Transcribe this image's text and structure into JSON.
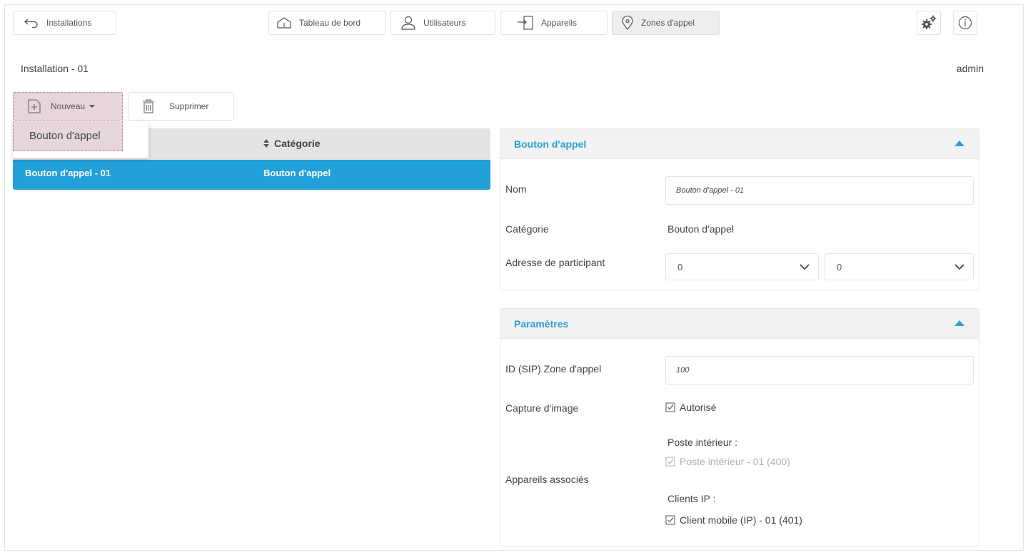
{
  "nav": {
    "back_label": "Installations",
    "tabs": [
      {
        "label": "Tableau de bord",
        "icon": "home-icon"
      },
      {
        "label": "Utilisateurs",
        "icon": "user-icon"
      },
      {
        "label": "Appareils",
        "icon": "device-icon"
      },
      {
        "label": "Zones d'appel",
        "icon": "location-pin-icon",
        "active": true
      }
    ],
    "settings_icon": "gears-icon",
    "info_icon": "info-icon"
  },
  "header": {
    "installation": "Installation - 01",
    "user": "admin"
  },
  "toolbar": {
    "new_label": "Nouveau",
    "delete_label": "Supprimer",
    "dropdown_items": [
      "Bouton d'appel"
    ]
  },
  "table": {
    "columns": [
      "Catégorie"
    ],
    "rows": [
      {
        "name": "Bouton d'appel - 01",
        "category": "Bouton d'appel",
        "selected": true
      }
    ]
  },
  "panel_main": {
    "title": "Bouton d'appel",
    "name_label": "Nom",
    "name_value": "Bouton d'appel - 01",
    "category_label": "Catégorie",
    "category_value": "Bouton d'appel",
    "address_label": "Adresse de participant",
    "address_values": [
      "0",
      "0"
    ]
  },
  "panel_params": {
    "title": "Paramètres",
    "sip_label": "ID (SIP) Zone d'appel",
    "sip_value": "100",
    "capture_label": "Capture d'image",
    "capture_option": "Autorisé",
    "devices_label": "Appareils associés",
    "indoor_group": "Poste intérieur :",
    "indoor_item": "Poste intérieur - 01 (400)",
    "ip_group": "Clients IP :",
    "ip_item": "Client mobile (IP) - 01 (401)"
  },
  "colors": {
    "accent": "#21a0d9",
    "panel_title": "#2a9fd6",
    "highlight": "#e6d5dd"
  }
}
